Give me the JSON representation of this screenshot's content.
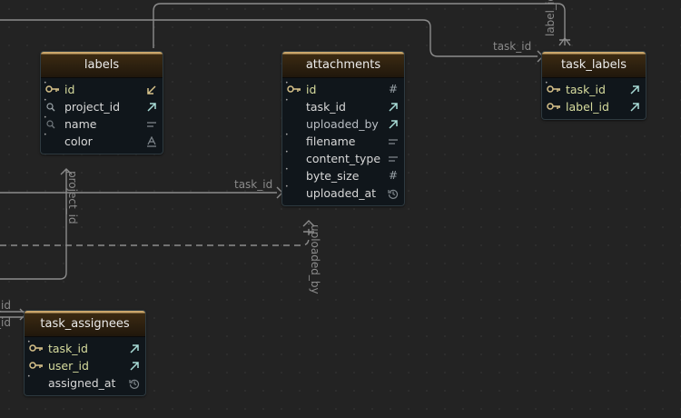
{
  "tables": {
    "labels": {
      "name": "labels",
      "columns": [
        {
          "name": "id",
          "key": "primary",
          "type_icon": "arrow-down-left-icon"
        },
        {
          "name": "project_id",
          "key": "index",
          "type_icon": "arrow-up-right-icon"
        },
        {
          "name": "name",
          "key": "none",
          "type_icon": "text-lines-icon"
        },
        {
          "name": "color",
          "key": "none",
          "type_icon": "letter-a-icon"
        }
      ]
    },
    "attachments": {
      "name": "attachments",
      "columns": [
        {
          "name": "id",
          "key": "primary",
          "type_icon": "hash-icon"
        },
        {
          "name": "task_id",
          "key": "none",
          "type_icon": "arrow-up-right-icon"
        },
        {
          "name": "uploaded_by",
          "key": "none",
          "type_icon": "arrow-up-right-icon"
        },
        {
          "name": "filename",
          "key": "none",
          "type_icon": "text-lines-icon"
        },
        {
          "name": "content_type",
          "key": "none",
          "type_icon": "text-lines-icon"
        },
        {
          "name": "byte_size",
          "key": "none",
          "type_icon": "hash-icon"
        },
        {
          "name": "uploaded_at",
          "key": "none",
          "type_icon": "history-icon"
        }
      ]
    },
    "task_labels": {
      "name": "task_labels",
      "columns": [
        {
          "name": "task_id",
          "key": "primary",
          "type_icon": "arrow-up-right-icon"
        },
        {
          "name": "label_id",
          "key": "primary",
          "type_icon": "arrow-up-right-icon"
        }
      ]
    },
    "task_assignees": {
      "name": "task_assignees",
      "columns": [
        {
          "name": "task_id",
          "key": "primary",
          "type_icon": "arrow-up-right-icon"
        },
        {
          "name": "user_id",
          "key": "primary",
          "type_icon": "arrow-up-right-icon"
        },
        {
          "name": "assigned_at",
          "key": "none",
          "type_icon": "history-icon"
        }
      ]
    }
  },
  "edge_labels": {
    "task_id_top": "task_id",
    "label_id_vertical": "label_id",
    "task_id_middle": "task_id",
    "project_id_vertical": "project_id",
    "uploaded_by_vertical": "uploaded_by",
    "left_id_1": "_id",
    "left_id_2": "_id"
  },
  "colors": {
    "canvas": "#232323",
    "table_body": "#10161b",
    "header_accent": "#caa66b",
    "primary_key_text": "#d7dc9e",
    "edge": "#8c8c8c"
  }
}
